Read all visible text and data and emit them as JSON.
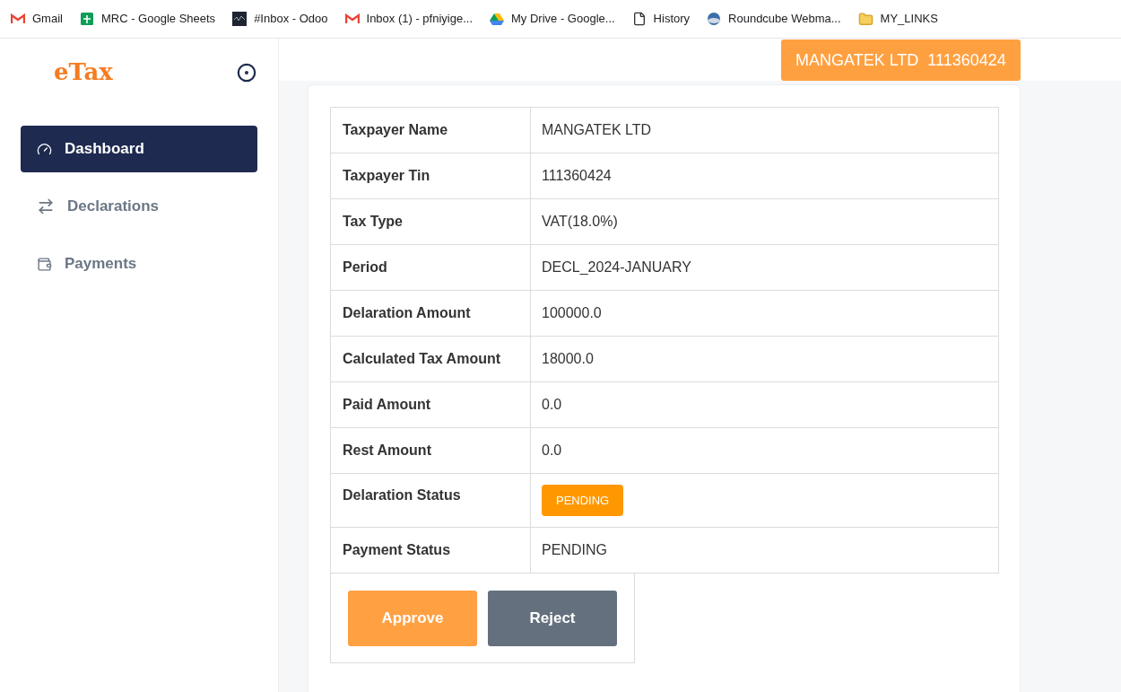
{
  "bookmarks": [
    {
      "label": "Gmail",
      "kind": "mail"
    },
    {
      "label": "MRC - Google Sheets",
      "kind": "sheet"
    },
    {
      "label": "#Inbox - Odoo",
      "kind": "dark"
    },
    {
      "label": "Inbox (1) - pfniyige...",
      "kind": "mail"
    },
    {
      "label": "My Drive - Google...",
      "kind": "drive"
    },
    {
      "label": "History",
      "kind": "page"
    },
    {
      "label": "Roundcube Webma...",
      "kind": "globe"
    },
    {
      "label": "MY_LINKS",
      "kind": "folder"
    }
  ],
  "logo": "eTax",
  "sidebar": {
    "items": [
      {
        "label": "Dashboard",
        "kind": "gauge",
        "selected": true
      },
      {
        "label": "Declarations",
        "kind": "arrows",
        "selected": false
      },
      {
        "label": "Payments",
        "kind": "wallet",
        "selected": false
      }
    ]
  },
  "header": {
    "account": "MANGATEK LTD  111360424"
  },
  "details": {
    "rows": [
      {
        "label": "Taxpayer Name",
        "value": "MANGATEK LTD",
        "kind": "text"
      },
      {
        "label": "Taxpayer Tin",
        "value": "111360424",
        "kind": "text"
      },
      {
        "label": "Tax Type",
        "value": "VAT(18.0%)",
        "kind": "text"
      },
      {
        "label": "Period",
        "value": "DECL_2024-JANUARY",
        "kind": "text"
      },
      {
        "label": "Delaration Amount",
        "value": "100000.0",
        "kind": "text"
      },
      {
        "label": "Calculated Tax Amount",
        "value": "18000.0",
        "kind": "text"
      },
      {
        "label": "Paid Amount",
        "value": "0.0",
        "kind": "text"
      },
      {
        "label": "Rest Amount",
        "value": "0.0",
        "kind": "text"
      },
      {
        "label": "Delaration Status",
        "value": "PENDING",
        "kind": "badge"
      },
      {
        "label": "Payment Status",
        "value": "PENDING",
        "kind": "text"
      }
    ]
  },
  "actions": [
    {
      "label": "Approve",
      "kind": "primary"
    },
    {
      "label": "Reject",
      "kind": "secondary"
    }
  ]
}
